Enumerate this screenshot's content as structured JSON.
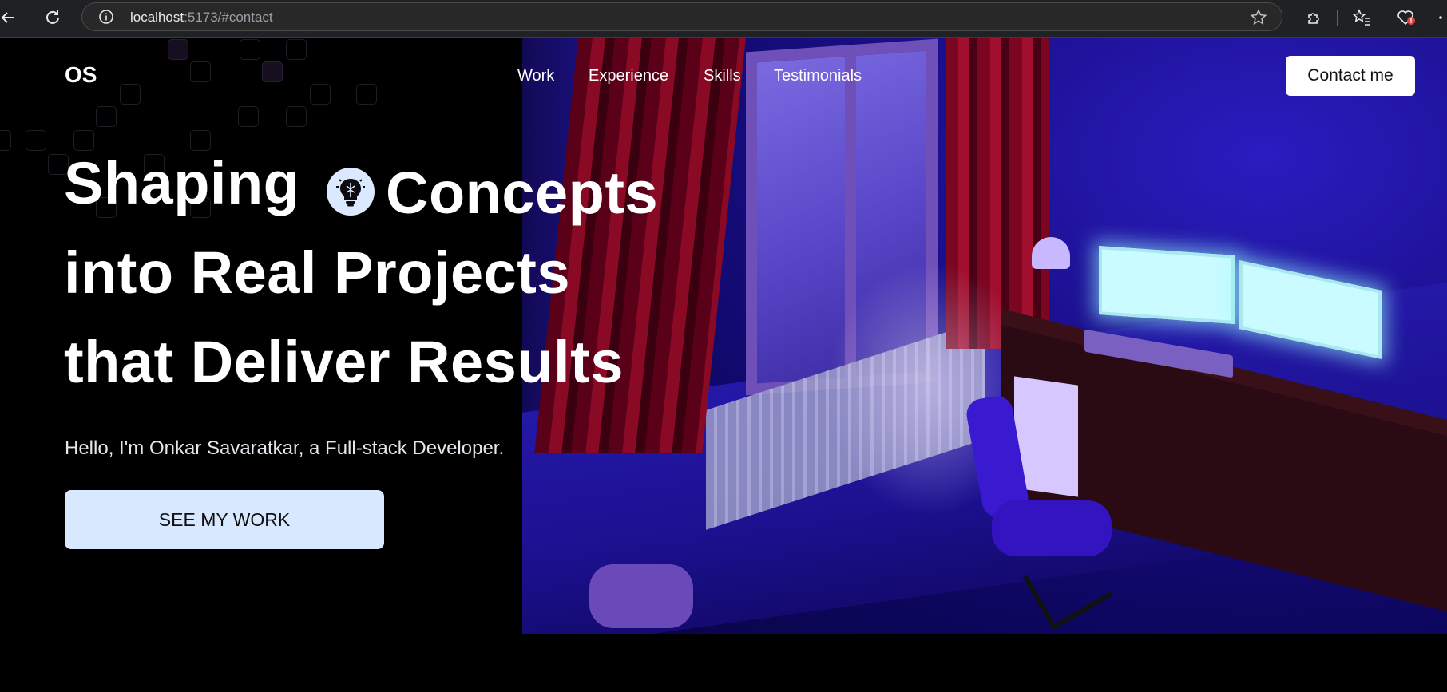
{
  "browser": {
    "url_host": "localhost",
    "url_rest": ":5173/#contact",
    "icons": [
      "back-icon",
      "reload-icon",
      "info-icon",
      "star-icon",
      "extensions-icon",
      "favorites-icon",
      "browser-essentials-icon"
    ]
  },
  "site": {
    "logo": "OS",
    "nav": [
      "Work",
      "Experience",
      "Skills",
      "Testimonials"
    ],
    "contact_button": "Contact me"
  },
  "hero": {
    "line1_word1": "Shaping",
    "line1_word2": "Concepts",
    "line2": "into Real Projects",
    "line3": "that Deliver Results",
    "badge_icon": "lightbulb-brain-icon",
    "intro": "Hello, I'm Onkar Savaratkar, a Full-stack Developer.",
    "cta": "SEE MY WORK"
  },
  "colors": {
    "background": "#000000",
    "cta_bg": "#d8e8ff",
    "badge_bg": "#dbe9ff",
    "text": "#ffffff"
  }
}
